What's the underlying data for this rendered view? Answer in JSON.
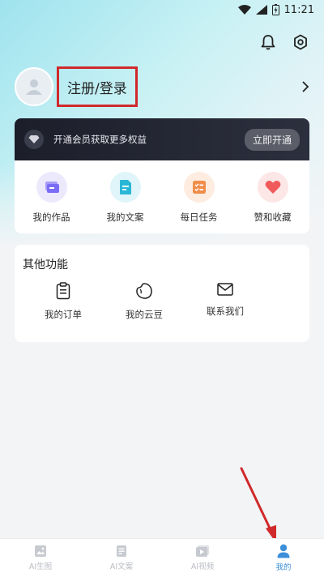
{
  "status_bar": {
    "time": "11:21"
  },
  "profile": {
    "login_label": "注册/登录"
  },
  "vip": {
    "text": "开通会员获取更多权益",
    "button_label": "立即开通"
  },
  "features": [
    {
      "label": "我的作品",
      "icon": "works-icon",
      "color": "#7b6cf6"
    },
    {
      "label": "我的文案",
      "icon": "copywriting-icon",
      "color": "#2ab7d6"
    },
    {
      "label": "每日任务",
      "icon": "daily-task-icon",
      "color": "#f08d4b"
    },
    {
      "label": "赞和收藏",
      "icon": "heart-icon",
      "color": "#f05a5a"
    }
  ],
  "other": {
    "title": "其他功能",
    "items": [
      {
        "label": "我的订单",
        "icon": "clipboard-icon"
      },
      {
        "label": "我的云豆",
        "icon": "bean-icon"
      },
      {
        "label": "联系我们",
        "icon": "mail-icon"
      }
    ]
  },
  "tabbar": {
    "tabs": [
      {
        "label": "AI生图",
        "icon": "image-icon",
        "active": false
      },
      {
        "label": "AI文案",
        "icon": "document-icon",
        "active": false
      },
      {
        "label": "AI视频",
        "icon": "video-icon",
        "active": false
      },
      {
        "label": "我的",
        "icon": "person-icon",
        "active": true
      }
    ]
  },
  "colors": {
    "accent": "#3b8fd9",
    "annotation": "#d0292b"
  }
}
